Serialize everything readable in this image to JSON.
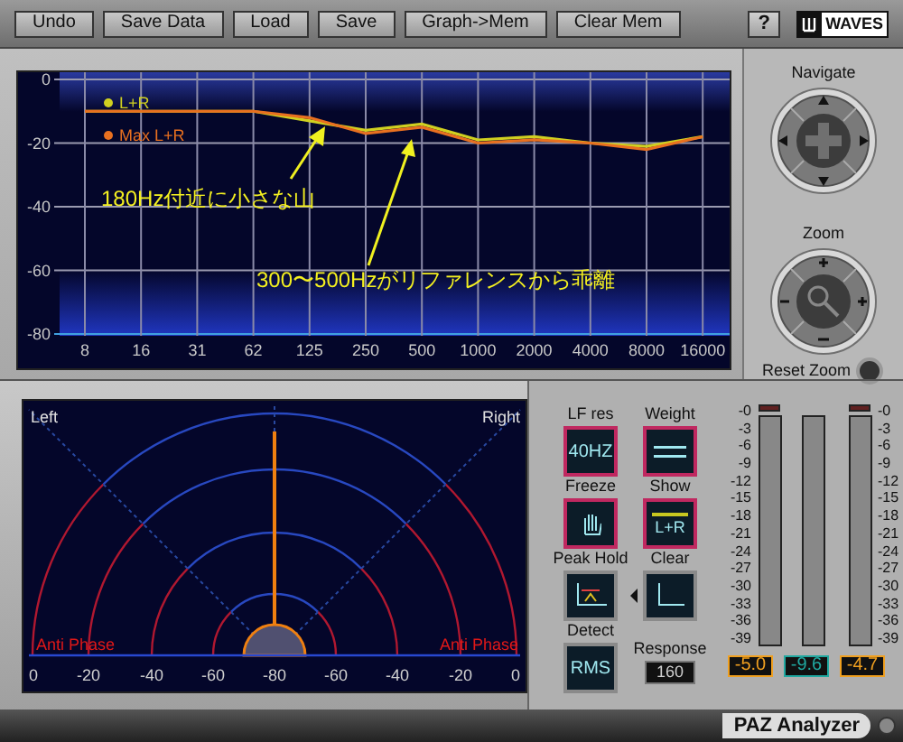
{
  "toolbar": {
    "buttons": [
      "Undo",
      "Save Data",
      "Load",
      "Save",
      "Graph->Mem",
      "Clear Mem"
    ],
    "help": "?",
    "logo": "WAVES"
  },
  "spectrum": {
    "chart_data": {
      "type": "line",
      "grid": true,
      "legend": true,
      "categories": [
        "8",
        "16",
        "31",
        "62",
        "125",
        "250",
        "500",
        "1000",
        "2000",
        "4000",
        "8000",
        "16000"
      ],
      "ylim": [
        -80,
        0
      ],
      "yticks": [
        0,
        -20,
        -40,
        -60,
        -80
      ],
      "series": [
        {
          "name": "L+R",
          "color": "#d0d020",
          "values": [
            -10,
            -10,
            -10,
            -10,
            -13,
            -16,
            -14,
            -19,
            -18,
            -20,
            -21,
            -18
          ]
        },
        {
          "name": "Max L+R",
          "color": "#e87020",
          "values": [
            -10,
            -10,
            -10,
            -10,
            -12,
            -17,
            -15,
            -20,
            -19,
            -20,
            -22,
            -18
          ]
        }
      ],
      "annotations": [
        {
          "text": "180Hz付近に小さな山"
        },
        {
          "text": "300〜500Hzがリファレンスから乖離"
        }
      ]
    }
  },
  "navigate": {
    "label": "Navigate"
  },
  "zoom": {
    "label": "Zoom",
    "reset": "Reset Zoom"
  },
  "phase_meter": {
    "left": "Left",
    "right": "Right",
    "anti_phase": [
      "Anti Phase",
      "Anti Phase"
    ],
    "left_scale": [
      "0",
      "-20",
      "-40",
      "-60"
    ],
    "center_label": "-80",
    "right_scale": [
      "-60",
      "-40",
      "-20",
      "0"
    ]
  },
  "controls": [
    {
      "label": "LF res",
      "kind": "text",
      "value": "40HZ",
      "active": true
    },
    {
      "label": "Weight",
      "kind": "weight",
      "active": true
    },
    {
      "label": "Freeze",
      "kind": "hand",
      "active": true
    },
    {
      "label": "Show",
      "kind": "show",
      "value": "L+R",
      "active": true
    },
    {
      "label": "Peak Hold",
      "kind": "peak",
      "active": false
    },
    {
      "label": "Clear",
      "kind": "clear",
      "active": false
    },
    {
      "label": "Detect",
      "kind": "text",
      "value": "RMS",
      "active": false
    }
  ],
  "response": {
    "label": "Response",
    "value": "160"
  },
  "meters": {
    "left_scale": [
      "-0",
      "-3",
      "-6",
      "-9",
      "-12",
      "-15",
      "-18",
      "-21",
      "-24",
      "-27",
      "-30",
      "-33",
      "-36",
      "-39"
    ],
    "right_scale": [
      "-0",
      "-3",
      "-6",
      "-9",
      "-12",
      "-15",
      "-18",
      "-21",
      "-24",
      "-27",
      "-30",
      "-33",
      "-36",
      "-39"
    ],
    "readouts": [
      {
        "value": "-5.0",
        "color": "#f0a020"
      },
      {
        "value": "-9.6",
        "color": "#20a8a0"
      },
      {
        "value": "-4.7",
        "color": "#f0a020"
      }
    ]
  },
  "footer": {
    "title": "PAZ Analyzer"
  }
}
